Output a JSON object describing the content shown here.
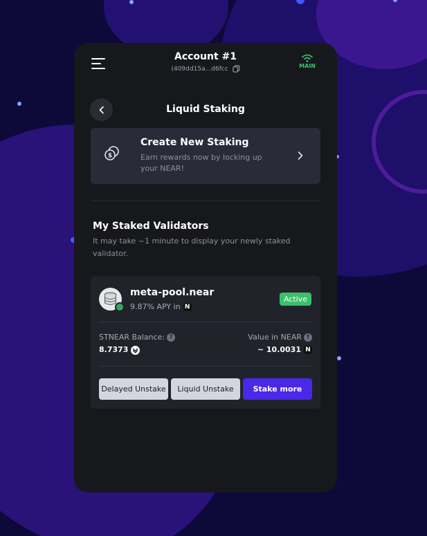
{
  "header": {
    "account_name": "Account #1",
    "account_address": "(409dd15a...d6fcc",
    "network": "MAIN"
  },
  "page": {
    "title": "Liquid Staking"
  },
  "create_staking": {
    "title": "Create New Staking",
    "description": "Earn rewards now by locking up your NEAR!"
  },
  "validators_section": {
    "title": "My Staked Validators",
    "description": "It may take ~1 minute to display your newly staked validator."
  },
  "validator": {
    "name": "meta-pool.near",
    "apy": "9.87% APY in",
    "apy_token_glyph": "N",
    "status": "Active",
    "balance_label": "STNEAR Balance:",
    "balance_value": "8.7373",
    "value_label": "Value in NEAR",
    "value_amount": "~ 10.0031",
    "value_token_glyph": "N",
    "buttons": {
      "delayed_unstake": "Delayed Unstake",
      "liquid_unstake": "Liquid Unstake",
      "stake_more": "Stake more"
    }
  },
  "colors": {
    "panel_bg": "#17181c",
    "card_bg": "#2a2b38",
    "accent": "#4a28e8",
    "success": "#3cbf6b",
    "network_green": "#35c26f"
  },
  "icons": {
    "menu": "hamburger-menu-icon",
    "copy": "copy-icon",
    "network": "wifi-icon",
    "back": "chevron-left-icon",
    "create": "coins-icon",
    "chevron": "chevron-right-icon",
    "help": "question-circle-icon",
    "validator_logo": "database-icon",
    "stnear": "stnear-token-icon",
    "near": "near-token-icon"
  }
}
